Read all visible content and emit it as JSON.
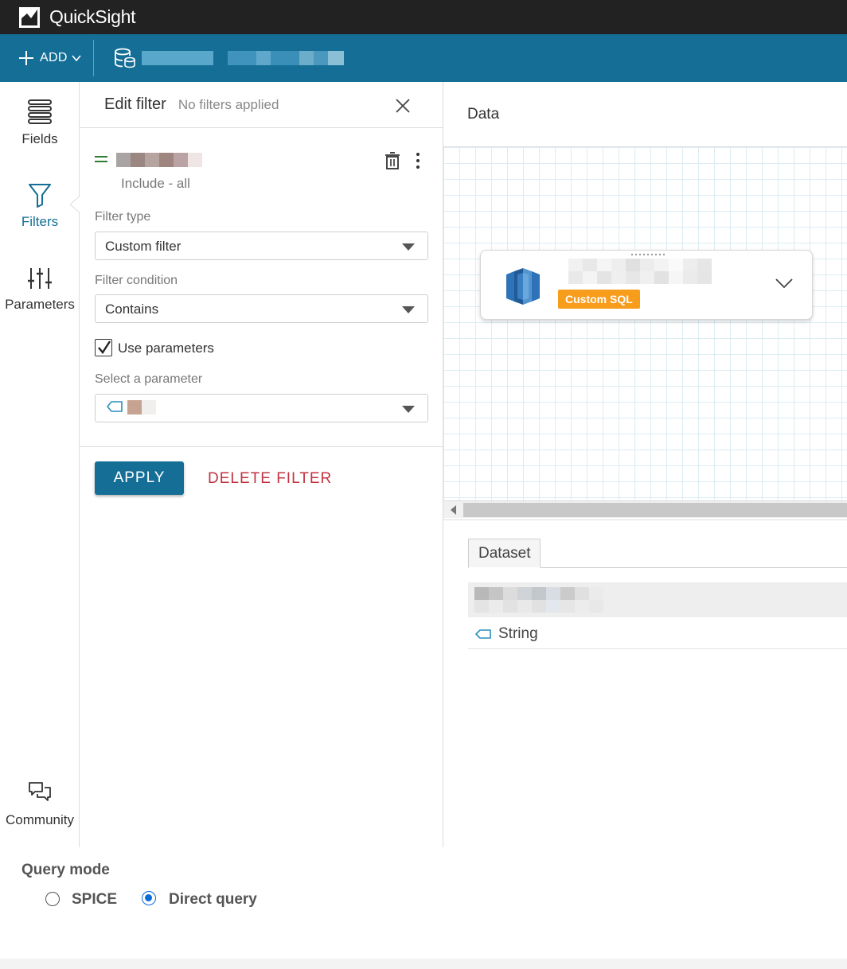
{
  "app": {
    "title": "QuickSight"
  },
  "toolbar": {
    "add_label": "ADD"
  },
  "rail": {
    "items": [
      {
        "label": "Fields"
      },
      {
        "label": "Filters"
      },
      {
        "label": "Parameters"
      },
      {
        "label": "Community"
      }
    ]
  },
  "filter_panel": {
    "title": "Edit filter",
    "subtitle": "No filters applied",
    "include_text": "Include - all",
    "filter_type_label": "Filter type",
    "filter_type_value": "Custom filter",
    "filter_condition_label": "Filter condition",
    "filter_condition_value": "Contains",
    "use_parameters_label": "Use parameters",
    "use_parameters_checked": true,
    "select_parameter_label": "Select a parameter",
    "apply_label": "APPLY",
    "delete_label": "DELETE FILTER"
  },
  "data_area": {
    "title": "Data",
    "card_badge": "Custom SQL",
    "tab_label": "Dataset",
    "type_label": "String"
  },
  "query_mode": {
    "title": "Query mode",
    "options": [
      {
        "label": "SPICE",
        "selected": false
      },
      {
        "label": "Direct query",
        "selected": true
      }
    ]
  },
  "colors": {
    "toolbar": "#146e96",
    "titlebar": "#222222",
    "badge": "#f89c1c",
    "delete": "#c0333f",
    "radio_selected": "#0b6cd6"
  }
}
